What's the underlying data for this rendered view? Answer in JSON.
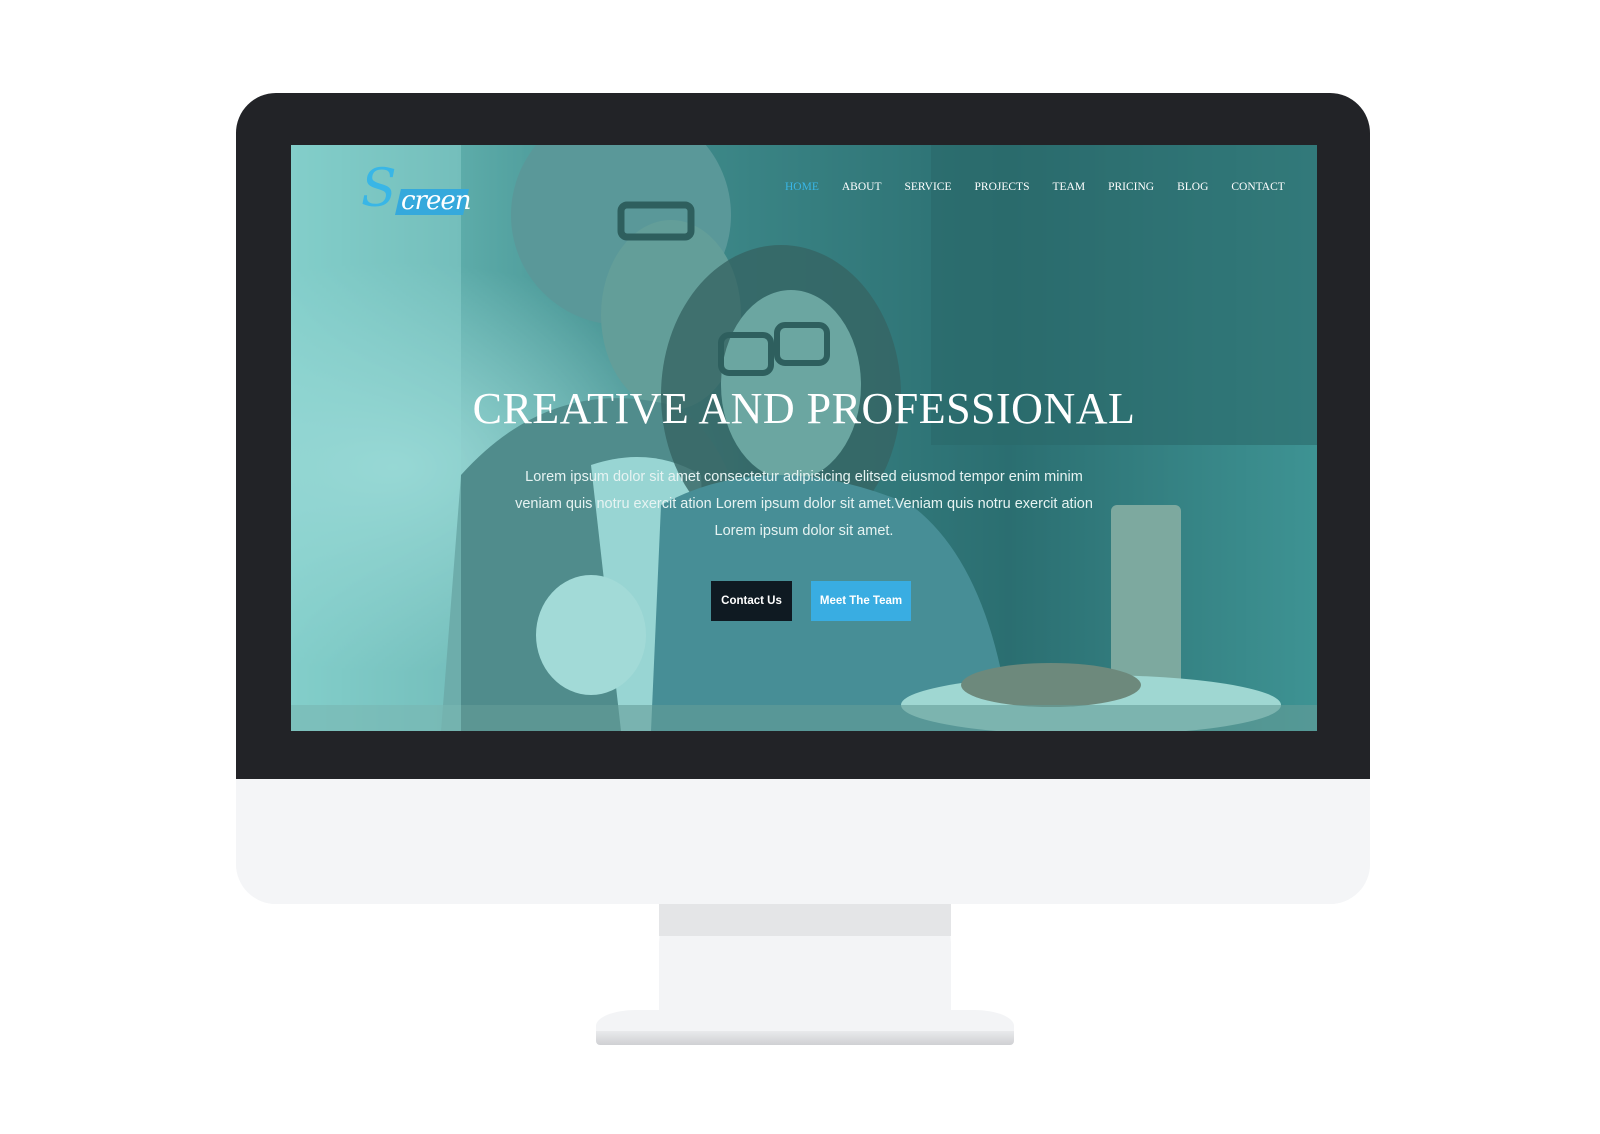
{
  "logo": {
    "initial": "S",
    "rest": "creen"
  },
  "nav": {
    "items": [
      {
        "label": "HOME",
        "active": true
      },
      {
        "label": "ABOUT",
        "active": false
      },
      {
        "label": "SERVICE",
        "active": false
      },
      {
        "label": "PROJECTS",
        "active": false
      },
      {
        "label": "TEAM",
        "active": false
      },
      {
        "label": "PRICING",
        "active": false
      },
      {
        "label": "BLOG",
        "active": false
      },
      {
        "label": "CONTACT",
        "active": false
      }
    ]
  },
  "hero": {
    "title": "CREATIVE AND PROFESSIONAL",
    "text": "Lorem ipsum dolor sit amet consectetur adipisicing elitsed eiusmod tempor enim minim veniam quis notru exercit ation Lorem ipsum dolor sit amet.Veniam quis notru exercit ation Lorem ipsum dolor sit amet.",
    "primary_button": "Contact Us",
    "secondary_button": "Meet The Team"
  },
  "colors": {
    "accent": "#39b6e6",
    "overlay": "#40b4b2",
    "bezel": "#222327",
    "dark_button": "#0f1a22"
  }
}
